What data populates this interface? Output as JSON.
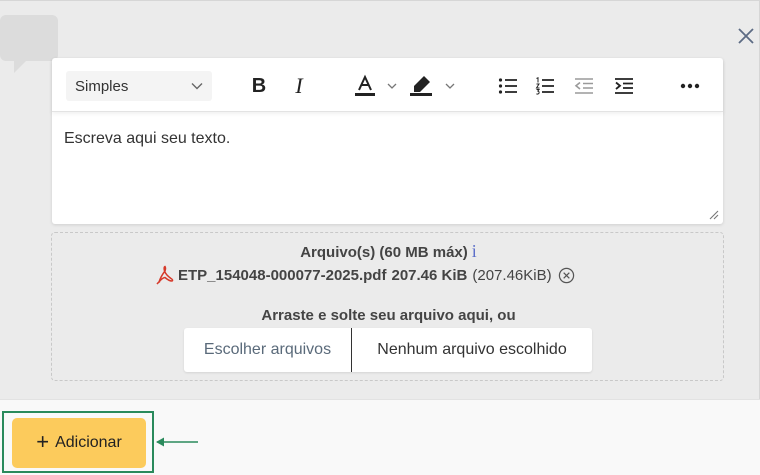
{
  "editor": {
    "format_select": "Simples",
    "bold_label": "B",
    "italic_label": "I",
    "body_text": "Escreva aqui seu texto."
  },
  "upload": {
    "title": "Arquivo(s) (60 MB máx)",
    "info_glyph": "i",
    "file": {
      "name": "ETP_154048-000077-2025.pdf",
      "size_bold": "207.46 KiB",
      "size_detail": "(207.46KiB)"
    },
    "drag_text": "Arraste e solte seu arquivo aqui, ou",
    "choose_label": "Escolher arquivos",
    "no_file_label": "Nenhum arquivo escolhido"
  },
  "actions": {
    "add_label": "Adicionar",
    "add_glyph": "+"
  },
  "colors": {
    "accent_yellow": "#fccb5c",
    "highlight_green": "#2a8a5c",
    "info_blue": "#5b6ec9",
    "pdf_red": "#d63a2b"
  },
  "icons": [
    "chat-bubble-icon",
    "close-icon",
    "chevron-down-icon",
    "bold-icon",
    "italic-icon",
    "font-color-icon",
    "highlight-icon",
    "bulleted-list-icon",
    "numbered-list-icon",
    "outdent-icon",
    "indent-icon",
    "more-icon",
    "pdf-icon",
    "remove-circle-icon",
    "resize-grip-icon",
    "arrow-left-icon"
  ]
}
